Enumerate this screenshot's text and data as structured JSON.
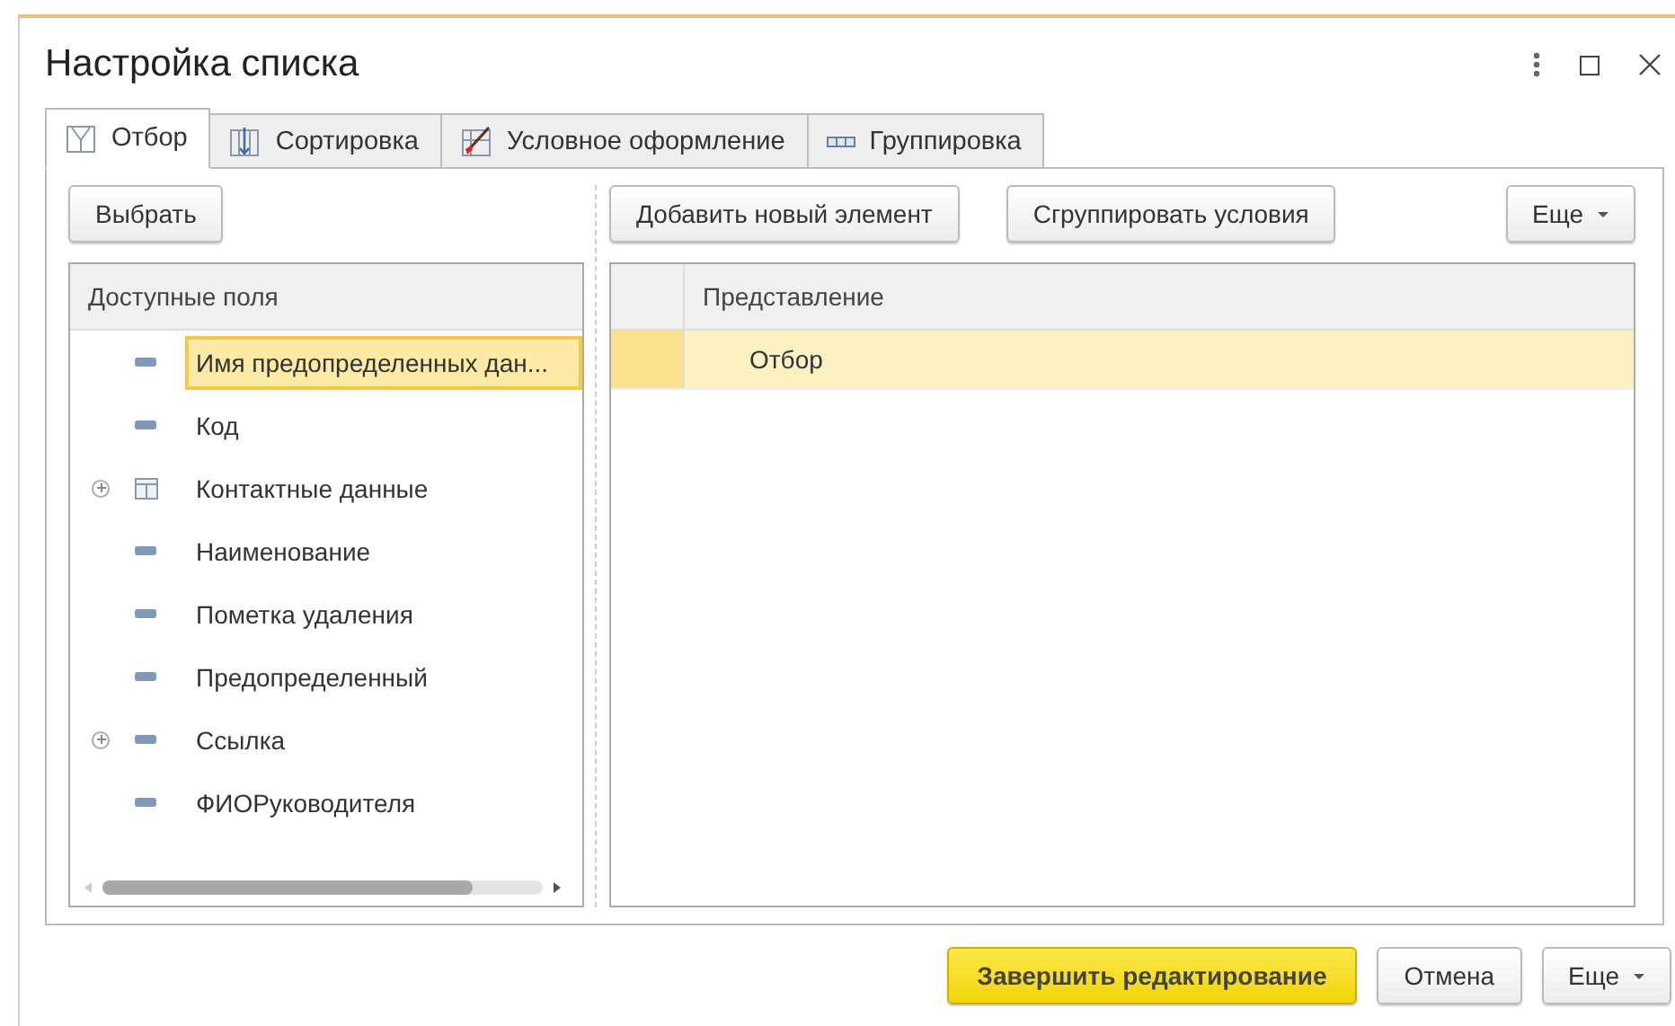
{
  "window": {
    "title": "Настройка списка"
  },
  "tabs": [
    {
      "label": "Отбор",
      "kind": "filter",
      "selected": true
    },
    {
      "label": "Сортировка",
      "kind": "sort",
      "selected": false
    },
    {
      "label": "Условное оформление",
      "kind": "brush",
      "selected": false
    },
    {
      "label": "Группировка",
      "kind": "group",
      "selected": false
    }
  ],
  "left": {
    "button": "Выбрать",
    "header": "Доступные поля",
    "items": [
      {
        "label": "Имя предопределенных дан...",
        "kind": "field",
        "expandable": false,
        "selected": true
      },
      {
        "label": "Код",
        "kind": "field",
        "expandable": false,
        "selected": false
      },
      {
        "label": "Контактные данные",
        "kind": "table",
        "expandable": true,
        "selected": false
      },
      {
        "label": "Наименование",
        "kind": "field",
        "expandable": false,
        "selected": false
      },
      {
        "label": "Пометка удаления",
        "kind": "field",
        "expandable": false,
        "selected": false
      },
      {
        "label": "Предопределенный",
        "kind": "field",
        "expandable": false,
        "selected": false
      },
      {
        "label": "Ссылка",
        "kind": "field",
        "expandable": true,
        "selected": false
      },
      {
        "label": "ФИОРуководителя",
        "kind": "field",
        "expandable": false,
        "selected": false
      }
    ]
  },
  "right": {
    "buttons": [
      "Добавить новый элемент",
      "Сгруппировать условия"
    ],
    "more": "Еще",
    "column": "Представление",
    "rows": [
      {
        "label": "Отбор",
        "selected": true
      }
    ]
  },
  "footer": {
    "primary": "Завершить редактирование",
    "cancel": "Отмена",
    "more": "Еще"
  }
}
